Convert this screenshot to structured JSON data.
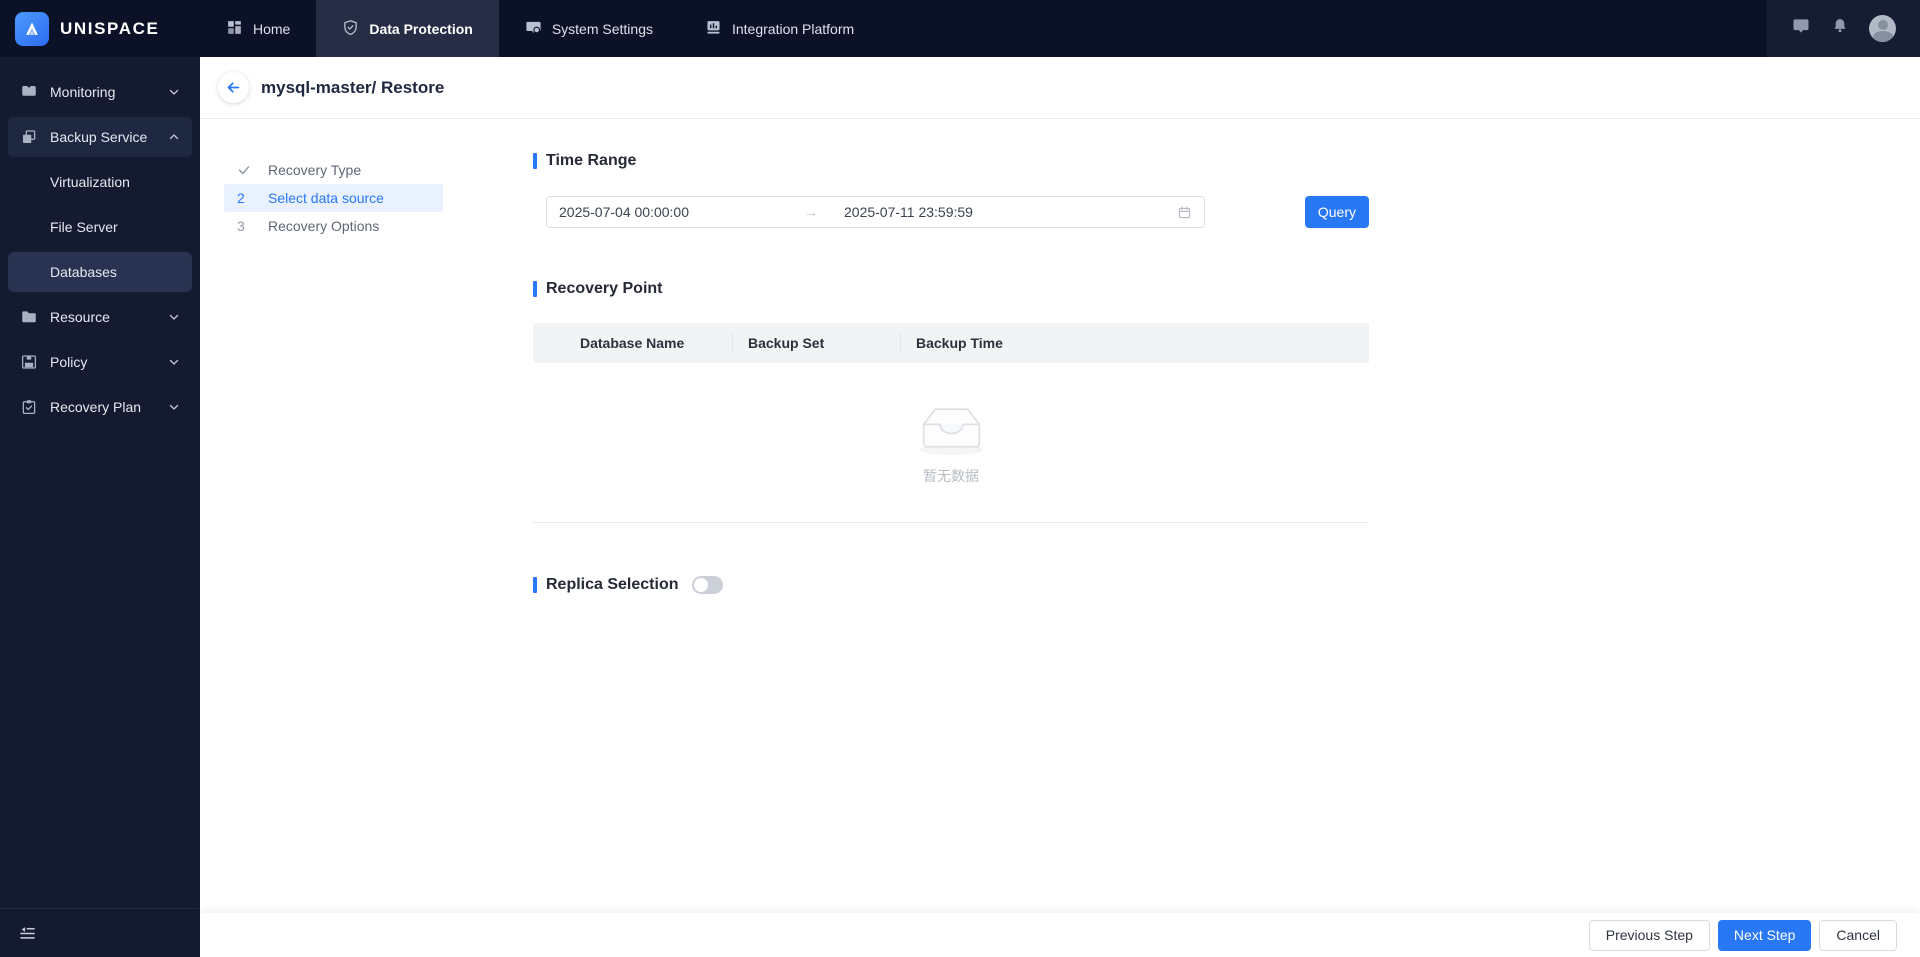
{
  "topbar": {
    "brand": "UNISPACE",
    "nav": [
      {
        "label": "Home",
        "icon": "grid-icon",
        "active": false
      },
      {
        "label": "Data Protection",
        "icon": "shield-check-icon",
        "active": true
      },
      {
        "label": "System Settings",
        "icon": "monitor-gear-icon",
        "active": false
      },
      {
        "label": "Integration Platform",
        "icon": "chart-box-icon",
        "active": false
      }
    ],
    "right_icons": [
      "chat-icon",
      "bell-icon",
      "avatar"
    ]
  },
  "sidebar": {
    "items": [
      {
        "label": "Monitoring",
        "icon": "message-icon",
        "chevron": "down"
      },
      {
        "label": "Backup Service",
        "icon": "copy-icon",
        "chevron": "up",
        "open": true
      },
      {
        "label": "Virtualization",
        "sub": true
      },
      {
        "label": "File Server",
        "sub": true
      },
      {
        "label": "Databases",
        "sub": true,
        "active": true
      },
      {
        "label": "Resource",
        "icon": "folder-icon",
        "chevron": "down"
      },
      {
        "label": "Policy",
        "icon": "save-icon",
        "chevron": "down"
      },
      {
        "label": "Recovery Plan",
        "icon": "clipboard-check-icon",
        "chevron": "down"
      }
    ]
  },
  "header": {
    "title": "mysql-master/ Restore"
  },
  "steps": [
    {
      "marker": "check",
      "label": "Recovery Type",
      "state": "done"
    },
    {
      "marker": "2",
      "label": "Select data source",
      "state": "active"
    },
    {
      "marker": "3",
      "label": "Recovery Options",
      "state": "pending"
    }
  ],
  "time_range": {
    "title": "Time Range",
    "start": "2025-07-04 00:00:00",
    "end": "2025-07-11 23:59:59",
    "arrow": "→",
    "query_label": "Query"
  },
  "recovery_point": {
    "title": "Recovery Point",
    "columns": [
      "Database Name",
      "Backup Set",
      "Backup Time"
    ],
    "empty_text": "暂无数据"
  },
  "replica": {
    "title": "Replica Selection",
    "enabled": false
  },
  "footer": {
    "previous_label": "Previous Step",
    "next_label": "Next Step",
    "cancel_label": "Cancel"
  },
  "colors": {
    "accent_blue": "#2878f6",
    "topbar_bg": "#0b1126",
    "topbar_active_bg": "#262d44",
    "sidebar_bg": "#141b31",
    "sidebar_open_bg": "#1f2841",
    "sidebar_active_bg": "#293351",
    "step_active_bg": "#e8f1fd",
    "table_header_bg": "#f2f3f5"
  }
}
